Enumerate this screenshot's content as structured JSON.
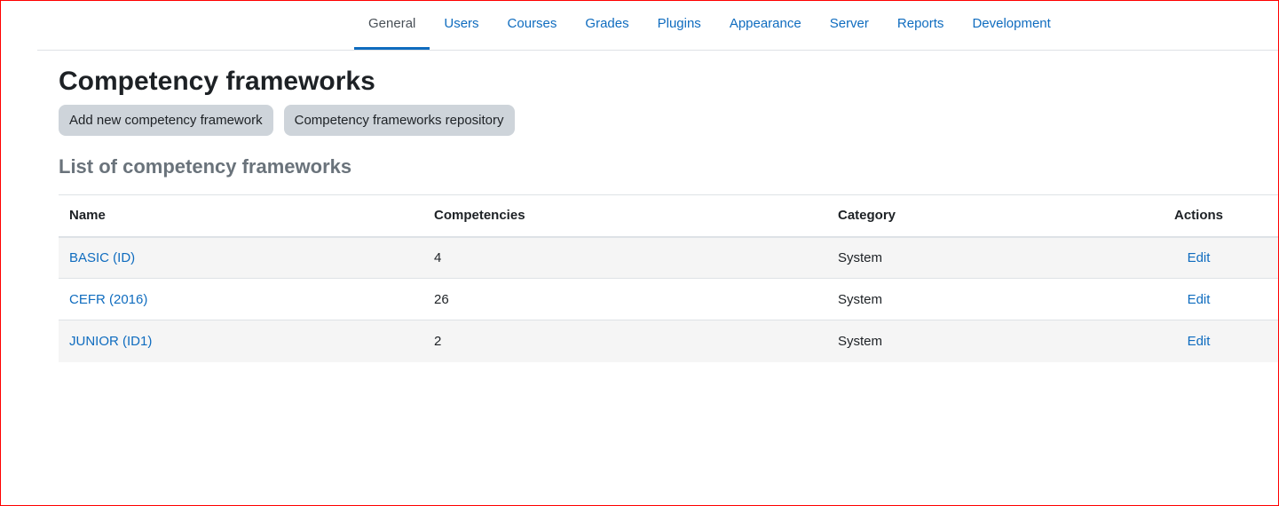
{
  "nav": {
    "tabs": [
      {
        "label": "General",
        "active": true
      },
      {
        "label": "Users",
        "active": false
      },
      {
        "label": "Courses",
        "active": false
      },
      {
        "label": "Grades",
        "active": false
      },
      {
        "label": "Plugins",
        "active": false
      },
      {
        "label": "Appearance",
        "active": false
      },
      {
        "label": "Server",
        "active": false
      },
      {
        "label": "Reports",
        "active": false
      },
      {
        "label": "Development",
        "active": false
      }
    ]
  },
  "page": {
    "title": "Competency frameworks",
    "buttons": {
      "add_new": "Add new competency framework",
      "repository": "Competency frameworks repository"
    },
    "section_title": "List of competency frameworks"
  },
  "table": {
    "headers": {
      "name": "Name",
      "competencies": "Competencies",
      "category": "Category",
      "actions": "Actions"
    },
    "rows": [
      {
        "name": "BASIC (ID)",
        "competencies": "4",
        "category": "System",
        "action": "Edit"
      },
      {
        "name": "CEFR (2016)",
        "competencies": "26",
        "category": "System",
        "action": "Edit"
      },
      {
        "name": "JUNIOR (ID1)",
        "competencies": "2",
        "category": "System",
        "action": "Edit"
      }
    ]
  },
  "colors": {
    "link": "#0f6cbf",
    "button_bg": "#ced4da",
    "section_title": "#6a737b",
    "frame_border": "#ff0000"
  }
}
